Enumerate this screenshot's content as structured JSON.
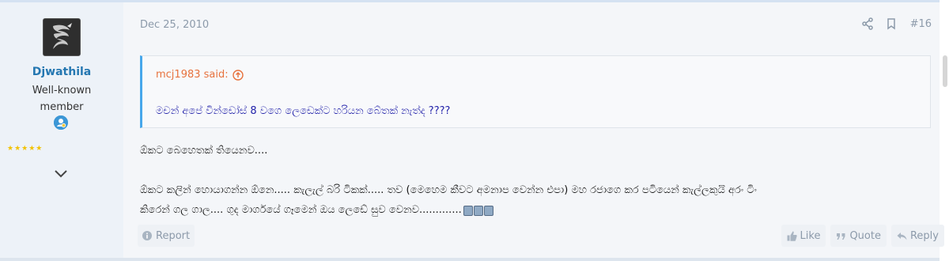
{
  "user": {
    "username": "Djwathila",
    "title": "Well-known member",
    "stars": "★★★★★",
    "avatar_icon": "dragon-icon",
    "badge_icon": "user-badge-icon"
  },
  "post": {
    "date": "Dec 25, 2010",
    "number": "#16",
    "quote": {
      "author_line": "mcj1983 said:",
      "text": "මචන් අපේ වින්ඩෝස් 8 වගෙ ලෙඩෙක්ට හරියන බේතක් නැත්ද ????"
    },
    "message": {
      "line1": "ඕකට බෙහෙතක් තියෙනව....",
      "line2": "ඕකට කලින් හොයාගන්න ඕනෙ..... කැලැල් බරි ටිකක්..... තව (මෙහෙම කීවට අමනාප වෙන්න එපා) මහ රජාගෙ කර පටියෙන් කැල්ලකුයි අරං ටිං",
      "line3": "කිරෙන් ගල ගාල.... ගුද මාර්ගයේ ගෑමෙන් ඔය ලෙඩේ සුව වෙනව............."
    }
  },
  "actions": {
    "report": "Report",
    "like": "Like",
    "quote": "Quote",
    "reply": "Reply"
  },
  "colors": {
    "username": "#2577b1",
    "quote_accent": "#47a7eb",
    "quote_author": "#e7723d",
    "quote_text": "#2222aa",
    "stars": "#f2c200"
  }
}
